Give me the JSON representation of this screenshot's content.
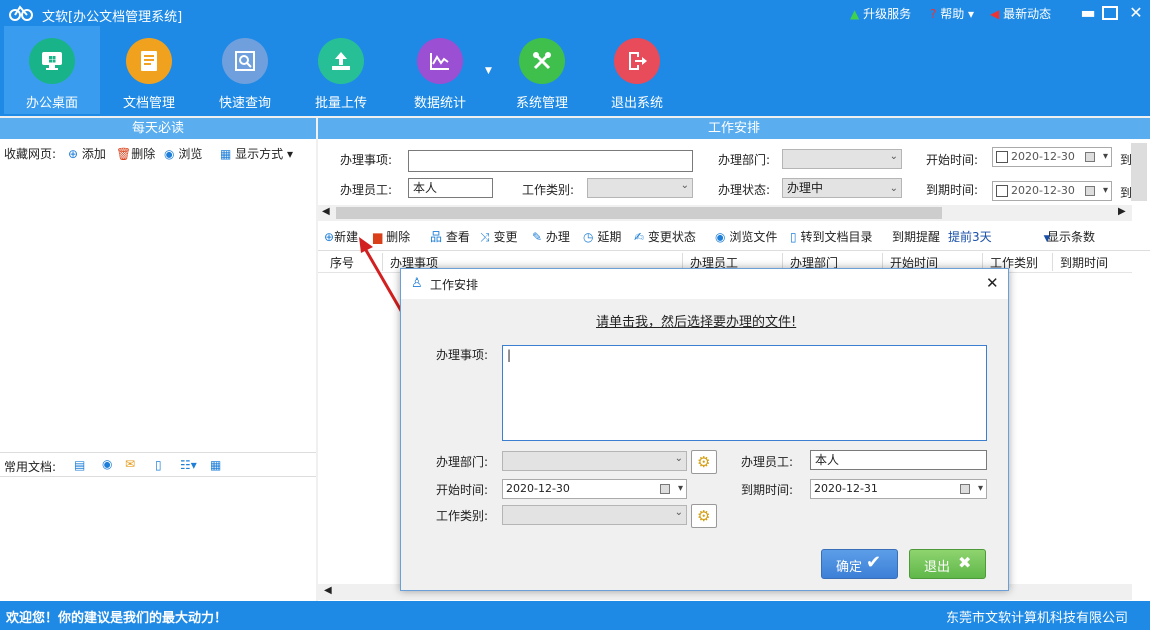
{
  "window": {
    "title": "文软[办公文档管理系统]",
    "upgrade": "升级服务",
    "help": "帮助",
    "news": "最新动态",
    "min": "▬",
    "max": "□",
    "close": "✕"
  },
  "toolbar": [
    {
      "label": "办公桌面",
      "color": "#19b38a",
      "icon": "monitor-icon"
    },
    {
      "label": "文档管理",
      "color": "#f0a21e",
      "icon": "document-icon"
    },
    {
      "label": "快速查询",
      "color": "#6f9fdc",
      "icon": "search-icon"
    },
    {
      "label": "批量上传",
      "color": "#27c096",
      "icon": "upload-icon"
    },
    {
      "label": "数据统计",
      "color": "#9b4fd2",
      "icon": "chart-icon"
    },
    {
      "label": "系统管理",
      "color": "#3fbf4c",
      "icon": "tools-icon"
    },
    {
      "label": "退出系统",
      "color": "#e84b5a",
      "icon": "exit-icon"
    }
  ],
  "left": {
    "daily_title": "每天必读",
    "fav_label": "收藏网页:",
    "add": "添加",
    "delete": "删除",
    "browse": "浏览",
    "display": "显示方式",
    "common_docs": "常用文档:"
  },
  "work": {
    "title": "工作安排",
    "matter_label": "办理事项:",
    "dept_label": "办理部门:",
    "start_label": "开始时间:",
    "staff_label": "办理员工:",
    "staff_value": "本人",
    "type_label": "工作类别:",
    "state_label": "办理状态:",
    "state_value": "办理中",
    "due_label": "到期时间:",
    "start_date": "2020-12-30",
    "due_date": "2020-12-30",
    "cut1": "到",
    "cut2": "到"
  },
  "actions": {
    "new": "新建",
    "delete": "删除",
    "view": "查看",
    "change": "变更",
    "handle": "办理",
    "delay": "延期",
    "change_state": "变更状态",
    "browse_file": "浏览文件",
    "goto_dir": "转到文档目录",
    "due_remind": "到期提醒",
    "remind_value": "提前3天",
    "show_count": "显示条数"
  },
  "columns": [
    "序号",
    "办理事项",
    "办理员工",
    "办理部门",
    "开始时间",
    "工作类别",
    "到期时间"
  ],
  "dialog": {
    "title": "工作安排",
    "link": "请单击我，然后选择要办理的文件!",
    "matter_label": "办理事项:",
    "matter_value": "|",
    "dept_label": "办理部门:",
    "staff_label": "办理员工:",
    "staff_value": "本人",
    "start_label": "开始时间:",
    "start_value": "2020-12-30",
    "due_label": "到期时间:",
    "due_value": "2020-12-31",
    "type_label": "工作类别:",
    "ok": "确定",
    "exit": "退出",
    "close": "✕"
  },
  "status": {
    "left": "欢迎您！你的建议是我们的最大动力！",
    "right": "东莞市文软计算机科技有限公司"
  }
}
